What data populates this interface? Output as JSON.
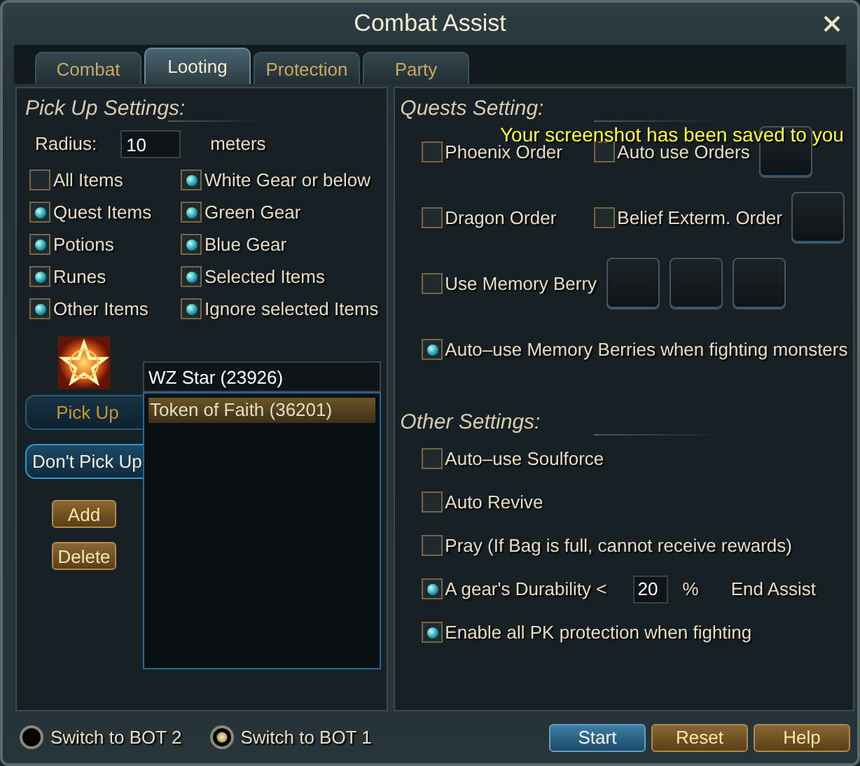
{
  "window": {
    "title": "Combat Assist"
  },
  "tabs": [
    {
      "label": "Combat",
      "selected": false
    },
    {
      "label": "Looting",
      "selected": true
    },
    {
      "label": "Protection",
      "selected": false
    },
    {
      "label": "Party",
      "selected": false
    }
  ],
  "pickup": {
    "heading": "Pick Up Settings:",
    "radius_label": "Radius:",
    "radius_value": "10",
    "radius_unit": "meters",
    "options": [
      {
        "label": "All Items",
        "checked": false
      },
      {
        "label": "White Gear or below",
        "checked": true
      },
      {
        "label": "Quest Items",
        "checked": true
      },
      {
        "label": "Green Gear",
        "checked": true
      },
      {
        "label": "Potions",
        "checked": true
      },
      {
        "label": "Blue Gear",
        "checked": true
      },
      {
        "label": "Runes",
        "checked": true
      },
      {
        "label": "Selected Items",
        "checked": true
      },
      {
        "label": "Other Items",
        "checked": true
      },
      {
        "label": "Ignore selected Items",
        "checked": true
      }
    ],
    "item_name": "WZ Star (23926)",
    "modes": [
      {
        "label": "Pick Up",
        "selected": false
      },
      {
        "label": "Don't Pick Up",
        "selected": true
      }
    ],
    "list": [
      {
        "label": "Token of Faith (36201)",
        "selected": true
      }
    ],
    "buttons": [
      "Add",
      "Delete"
    ]
  },
  "quests": {
    "heading": "Quests Setting:",
    "rows": [
      {
        "options": [
          {
            "label": "Phoenix Order",
            "checked": false
          },
          {
            "label": "Auto use Orders",
            "checked": false
          }
        ],
        "slots": [
          {
            "kind": "empty"
          }
        ]
      },
      {
        "options": [
          {
            "label": "Dragon Order",
            "checked": false
          },
          {
            "label": "Belief Exterm. Order",
            "checked": false
          }
        ],
        "slots": [
          {
            "kind": "empty"
          }
        ]
      },
      {
        "options": [
          {
            "label": "Use Memory Berry",
            "checked": false
          }
        ],
        "slots": [
          {
            "kind": "empty"
          },
          {
            "kind": "empty"
          },
          {
            "kind": "empty"
          }
        ]
      },
      {
        "options": [
          {
            "label": "Auto–use Memory Berries when fighting monsters",
            "checked": true
          }
        ]
      }
    ]
  },
  "other": {
    "heading": "Other Settings:",
    "rows": [
      {
        "kind": "check",
        "label": "Auto–use Soulforce",
        "checked": false
      },
      {
        "kind": "check",
        "label": "Auto Revive",
        "checked": false
      },
      {
        "kind": "check",
        "label": "Pray (If Bag is full, cannot receive rewards)",
        "checked": false
      },
      {
        "kind": "durability",
        "label": "A gear's Durability <",
        "checked": true,
        "value": "20",
        "unit": "%",
        "suffix": "End Assist"
      },
      {
        "kind": "check",
        "label": "Enable all PK protection when fighting",
        "checked": true
      }
    ]
  },
  "notification": "Your screenshot has been saved to you",
  "bot_switches": [
    {
      "label": "Switch to BOT 2",
      "selected": false
    },
    {
      "label": "Switch to BOT 1",
      "selected": true
    }
  ],
  "actions": [
    {
      "label": "Start",
      "kind": "primary"
    },
    {
      "label": "Reset",
      "kind": "secondary"
    },
    {
      "label": "Help",
      "kind": "secondary"
    }
  ]
}
